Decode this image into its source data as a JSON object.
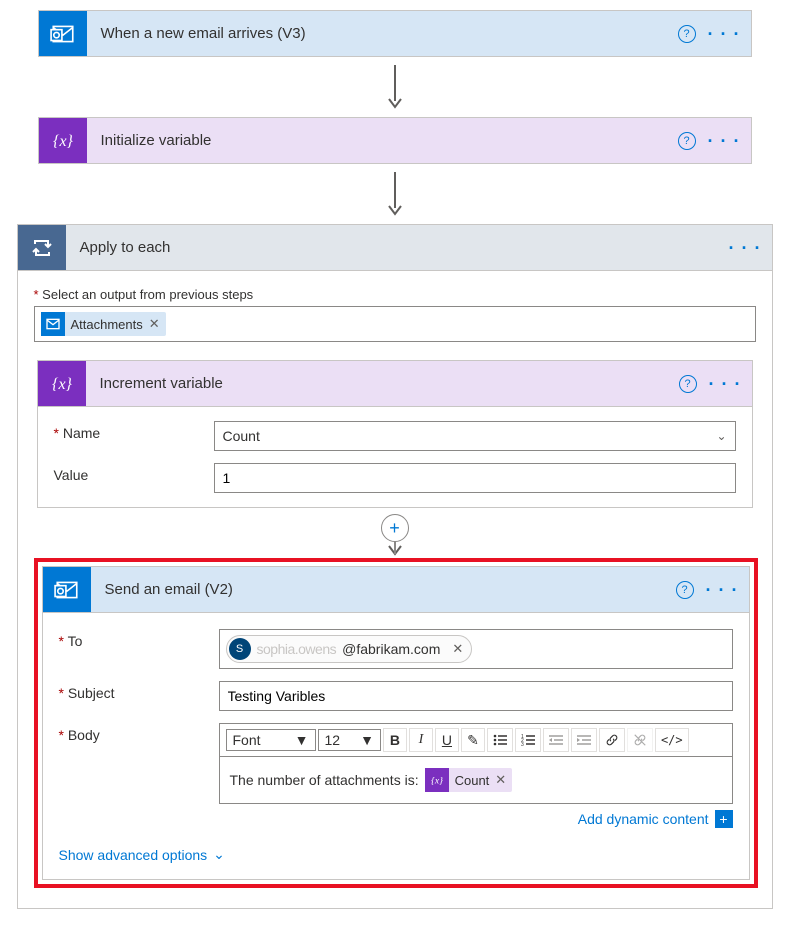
{
  "trigger": {
    "title": "When a new email arrives (V3)"
  },
  "init_var": {
    "title": "Initialize variable"
  },
  "apply_each": {
    "title": "Apply to each",
    "select_label": "Select an output from previous steps",
    "token": "Attachments"
  },
  "increment": {
    "title": "Increment variable",
    "name_label": "Name",
    "name_value": "Count",
    "value_label": "Value",
    "value_value": "1"
  },
  "send_email": {
    "title": "Send an email (V2)",
    "to_label": "To",
    "to_avatar": "S",
    "to_blurred": "sophia.owens",
    "to_domain": "@fabrikam.com",
    "subject_label": "Subject",
    "subject_value": "Testing Varibles",
    "body_label": "Body",
    "body_text": "The number of attachments is:",
    "body_token": "Count",
    "font_sel_label": "Font",
    "size_sel_label": "12",
    "add_dynamic": "Add dynamic content",
    "show_advanced": "Show advanced options"
  }
}
